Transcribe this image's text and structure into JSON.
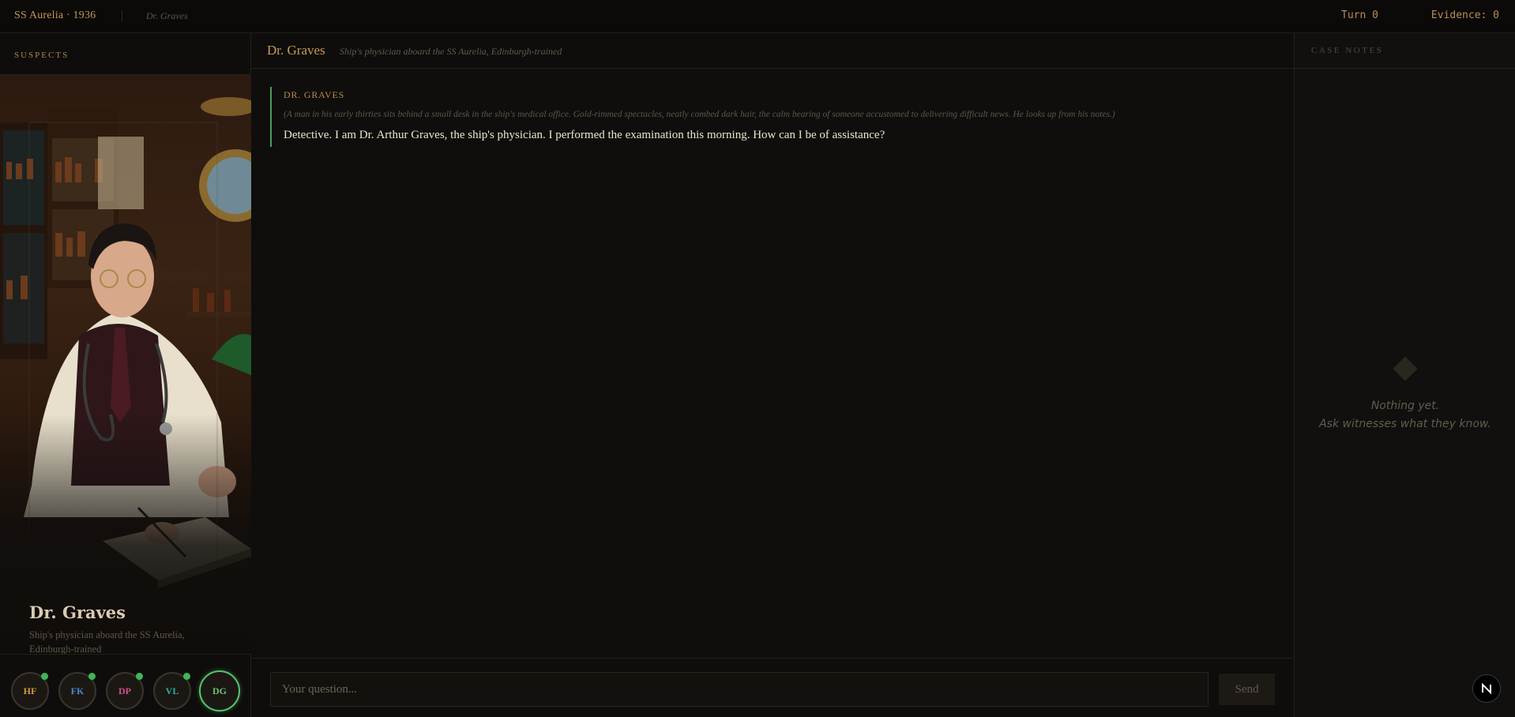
{
  "topbar": {
    "brand": "SS Aurelia · 1936",
    "current_suspect": "Dr. Graves",
    "turn_label": "Turn 0",
    "evidence_label": "Evidence: 0"
  },
  "sidebar": {
    "title": "SUSPECTS",
    "portrait": {
      "name": "Dr. Graves",
      "description": "Ship's physician aboard the SS Aurelia, Edinburgh-trained"
    },
    "avatars": [
      {
        "initials": "HF",
        "color": "#d09a3e",
        "online": true,
        "active": false
      },
      {
        "initials": "FK",
        "color": "#4f86cf",
        "online": true,
        "active": false
      },
      {
        "initials": "DP",
        "color": "#cf4f8d",
        "online": true,
        "active": false
      },
      {
        "initials": "VL",
        "color": "#2fae9c",
        "online": true,
        "active": false
      },
      {
        "initials": "DG",
        "color": "#6bbf79",
        "online": false,
        "active": true
      }
    ]
  },
  "main": {
    "header": {
      "name": "Dr. Graves",
      "subtitle": "Ship's physician aboard the SS Aurelia, Edinburgh-trained"
    },
    "message": {
      "speaker": "DR. GRAVES",
      "action": "(A man in his early thirties sits behind a small desk in the ship's medical office. Gold-rimmed spectacles, neatly combed dark hair, the calm bearing of someone accustomed to delivering difficult news. He looks up from his notes.)",
      "text": "Detective. I am Dr. Arthur Graves, the ship's physician. I performed the examination this morning. How can I be of assistance?"
    },
    "composer": {
      "placeholder": "Your question...",
      "send_label": "Send"
    }
  },
  "notes": {
    "title": "CASE NOTES",
    "empty_line1": "Nothing yet.",
    "empty_line2": "Ask witnesses what they know.",
    "badge": "N"
  },
  "colors": {
    "accent_gold": "#c29657",
    "active_green": "#57c46e",
    "online_dot": "#3db857"
  }
}
